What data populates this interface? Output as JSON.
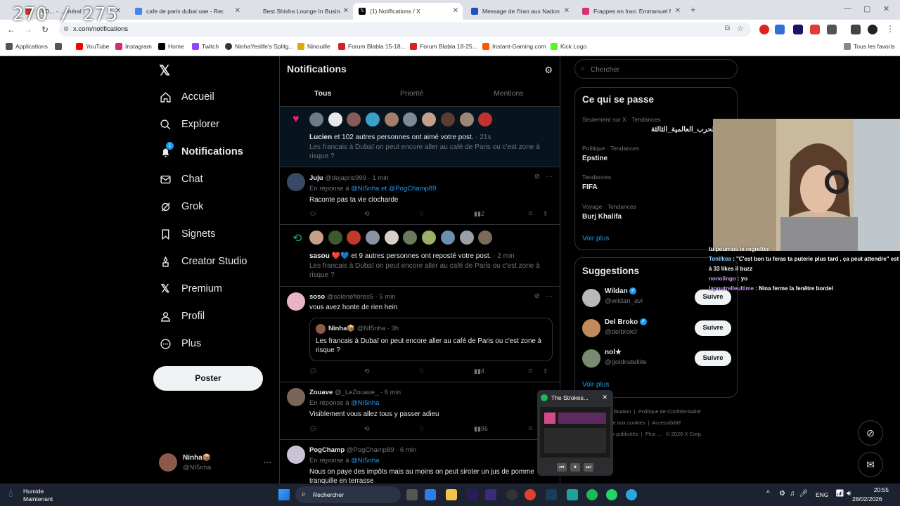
{
  "overlay": {
    "counter": "270 / 275",
    "chat": [
      {
        "user": "",
        "text": "tu pourrais le regretter",
        "color": "#ffffff"
      },
      {
        "user": "Tonilkea",
        "text": "\"C'est bon tu feras ta puterie plus tard , ça peut attendre\" est à 33 likes il buzz",
        "color": "#7fd0ff"
      },
      {
        "user": "nonolingo",
        "text": "yo",
        "color": "#c79bff"
      },
      {
        "user": "lapoutrelleultime",
        "text": "Nina ferme la fenêtre bordel",
        "color": "#c79bff"
      }
    ]
  },
  "browser": {
    "tabs": [
      {
        "title": "...) D... - ...énéral |",
        "color": "#c0392b"
      },
      {
        "title": "cafe de paris dubai uae - Reche",
        "color": "#4285f4"
      },
      {
        "title": "Best Shisha Lounge In Business",
        "color": "#2e8b57"
      },
      {
        "title": "(1) Notifications / X",
        "color": "#000000"
      },
      {
        "title": "Message de l'Iran aux Nations",
        "color": "#1f4fbf"
      },
      {
        "title": "Frappes en Iran: Emmanuel Ma",
        "color": "#d6336c"
      }
    ],
    "url": "x.com/notifications",
    "bookmarks": [
      {
        "label": "Applications",
        "color": "#555555"
      },
      {
        "label": "",
        "color": "#555555"
      },
      {
        "label": "YouTube",
        "color": "#ff0000"
      },
      {
        "label": "Instagram",
        "color": "#d62976"
      },
      {
        "label": "Home",
        "color": "#000000"
      },
      {
        "label": "Twitch",
        "color": "#9146ff"
      },
      {
        "label": "NinhaYeslife's Splitg...",
        "color": "#333333"
      },
      {
        "label": "Ninouille",
        "color": "#e0a800"
      },
      {
        "label": "Forum Blabla 15-18...",
        "color": "#d62222"
      },
      {
        "label": "Forum Blabla 18-25...",
        "color": "#d62222"
      },
      {
        "label": "Instant-Gaming.com",
        "color": "#ff5400"
      },
      {
        "label": "Kick Logo",
        "color": "#53fc18"
      }
    ],
    "all_bookmarks": "Tous les favoris"
  },
  "nav": {
    "items": [
      {
        "label": "Accueil",
        "icon": "home-icon"
      },
      {
        "label": "Explorer",
        "icon": "search-icon"
      },
      {
        "label": "Notifications",
        "icon": "bell-icon",
        "badge": "1"
      },
      {
        "label": "Chat",
        "icon": "mail-icon"
      },
      {
        "label": "Grok",
        "icon": "grok-icon"
      },
      {
        "label": "Signets",
        "icon": "bookmark-icon"
      },
      {
        "label": "Creator Studio",
        "icon": "creator-icon"
      },
      {
        "label": "Premium",
        "icon": "x-icon"
      },
      {
        "label": "Profil",
        "icon": "person-icon"
      },
      {
        "label": "Plus",
        "icon": "more-circle-icon"
      }
    ],
    "post_label": "Poster",
    "me": {
      "name": "Ninha📦",
      "handle": "@NI5nha"
    }
  },
  "notifications": {
    "title": "Notifications",
    "tabs": [
      "Tous",
      "Priorité",
      "Mentions"
    ],
    "like": {
      "text_bold": "Lucien",
      "text": " et 102 autres personnes ont aimé votre post.",
      "time": " · 21s",
      "post": "Les francais à Dubaï on peut encore aller au café de Paris ou c'est zone à risque ?"
    },
    "juju": {
      "name": "Juju",
      "handle": "@dejapris999",
      "time": " · 1 min",
      "reply_prefix": "En réponse à ",
      "reply_to1": "@NI5nha",
      "reply_and": " et ",
      "reply_to2": "@PogChamp89",
      "body": "Raconte pas ta vie clocharde",
      "views": "2"
    },
    "repost": {
      "text_bold": "sasou ❤️💙",
      "text": " et 9 autres personnes ont reposté votre post.",
      "time": " · 2 min",
      "post": "Les francais à Dubaï on peut encore aller au café de Paris ou c'est zone à risque ?"
    },
    "soso": {
      "name": "soso",
      "handle": "@soleneflores5",
      "time": " · 5 min",
      "body": "vous avez honte de rien hein",
      "quote_name": "Ninha📦",
      "quote_handle": "@NI5nha",
      "quote_time": " · 3h",
      "quote_body": "Les francais à Dubaï on peut encore aller au café de Paris ou c'est zone à risque ?",
      "views": "4"
    },
    "zouave": {
      "name": "Zouave",
      "handle": "@_LeZouave_",
      "time": " · 6 min",
      "reply_prefix": "En réponse à ",
      "reply_to": "@NI5nha",
      "body": "Visiblement vous allez tous y passer adieu",
      "views": "96"
    },
    "pog": {
      "name": "PogChamp",
      "handle": "@PogChamp89",
      "time": " · 6 min",
      "reply_prefix": "En réponse à ",
      "reply_to": "@NI5nha",
      "body": "Nous on paye des impôts mais au moins on peut siroter un jus de pomme tranquille en terrasse"
    }
  },
  "right": {
    "search_placeholder": "Chercher",
    "trends_title": "Ce qui se passe",
    "trends": [
      {
        "cat": "Seulement sur X · Tendances",
        "name": "الحرب_العالمية_الثالثة"
      },
      {
        "cat": "Politique · Tendances",
        "name": "Epstine"
      },
      {
        "cat": "Tendances",
        "name": "FIFA"
      },
      {
        "cat": "Voyage · Tendances",
        "name": "Burj Khalifa"
      }
    ],
    "see_more": "Voir plus",
    "sugg_title": "Suggestions",
    "suggestions": [
      {
        "name": "Wildan",
        "handle": "@wildan_avi",
        "verified": true
      },
      {
        "name": "Del Broko",
        "handle": "@delbrok0",
        "verified": true
      },
      {
        "name": "nol★",
        "handle": "@goldnstellite",
        "verified": false
      }
    ],
    "follow_label": "Suivre",
    "footer": [
      "...utilisation",
      "Politique de Confidentialité",
      "...ive aux cookies",
      "Accessibilité",
      "...ux publicités",
      "Plus ...",
      "© 2026 X Corp."
    ]
  },
  "media": {
    "title": "The Strokes..."
  },
  "taskbar": {
    "weather_title": "Humide",
    "weather_sub": "Maintenant",
    "search": "Rechercher",
    "lang": "ENG",
    "time": "20:55",
    "date": "28/02/2026"
  }
}
